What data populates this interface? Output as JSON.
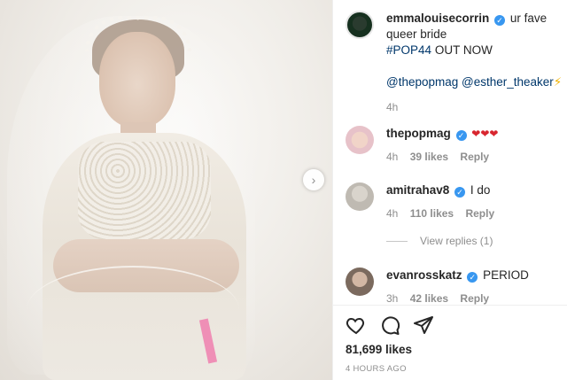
{
  "post": {
    "image_alt": "",
    "next_icon": "chevron-right"
  },
  "caption": {
    "username": "emmalouisecorrin",
    "text": "ur fave queer bride",
    "hashtag": "#POP44",
    "hashtag_suffix": "OUT NOW",
    "mention1": "@thepopmag",
    "mention2": "@esther_theaker",
    "emoji": "⚡",
    "time": "4h"
  },
  "comments": [
    {
      "username": "thepopmag",
      "text": "❤❤❤",
      "time": "4h",
      "likes": "39 likes",
      "reply": "Reply"
    },
    {
      "username": "amitrahav8",
      "text": "I do",
      "time": "4h",
      "likes": "110 likes",
      "reply": "Reply"
    },
    {
      "username": "evanrosskatz",
      "text": "PERIOD",
      "time": "3h",
      "likes": "42 likes",
      "reply": "Reply"
    }
  ],
  "view_replies": "View replies (1)",
  "actions": {
    "likes": "81,699 likes",
    "timestamp": "4 HOURS AGO"
  },
  "colors": {
    "link": "#00376b",
    "verified": "#3897f0",
    "muted": "#8e8e8e",
    "heart": "#d8262f"
  }
}
